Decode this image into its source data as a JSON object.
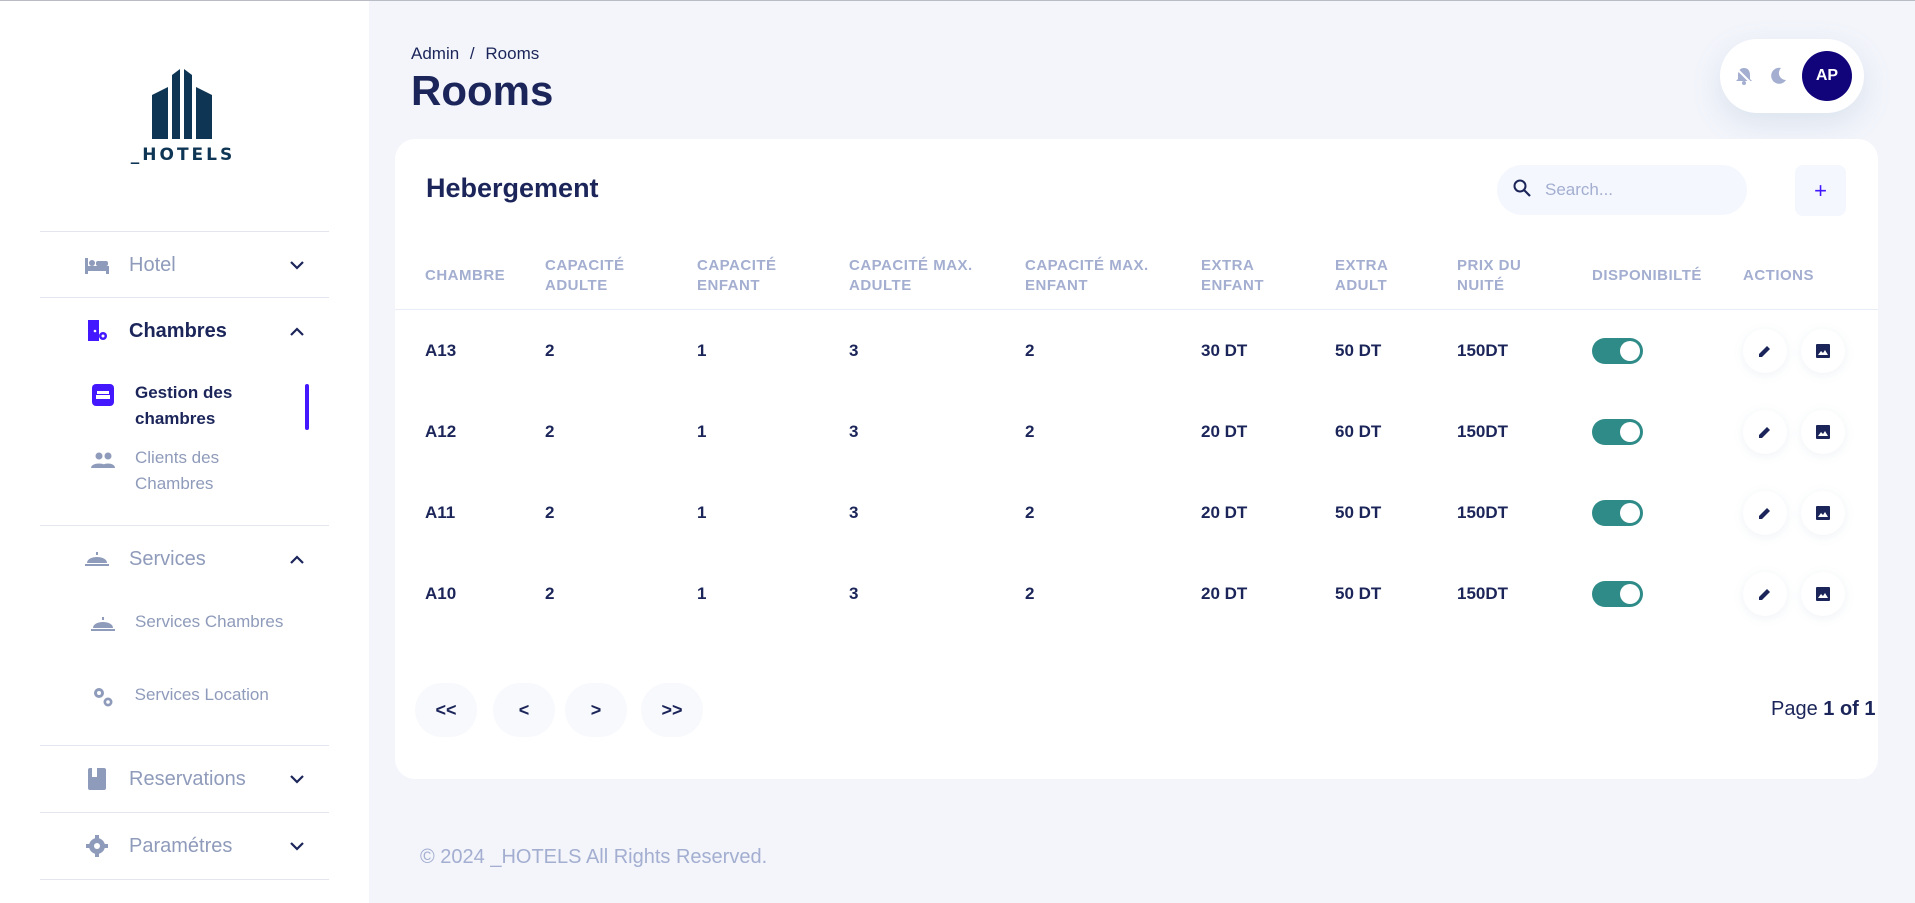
{
  "brand": {
    "logo_text": "_HOTELS"
  },
  "sidebar": {
    "groups": [
      {
        "label": "Hotel",
        "icon": "bed-icon"
      },
      {
        "label": "Chambres",
        "icon": "room-settings-icon"
      },
      {
        "label": "Services",
        "icon": "room-service-icon"
      },
      {
        "label": "Reservations",
        "icon": "book-icon"
      },
      {
        "label": "Paramétres",
        "icon": "gear-icon"
      }
    ],
    "chambres_items": [
      {
        "label": "Gestion des chambres",
        "icon": "hotel-icon"
      },
      {
        "label": "Clients des Chambres",
        "icon": "people-icon"
      }
    ],
    "services_items": [
      {
        "label": "Services Chambres",
        "icon": "room-service-icon"
      },
      {
        "label": "Services Location",
        "icon": "gears-icon"
      }
    ]
  },
  "header": {
    "breadcrumb": [
      "Admin",
      "/",
      "Rooms"
    ],
    "title": "Rooms",
    "avatar_initials": "AP"
  },
  "card": {
    "title": "Hebergement",
    "search_placeholder": "Search...",
    "add_label": "+"
  },
  "table": {
    "columns": [
      [
        "CHAMBRE"
      ],
      [
        "CAPACITÉ",
        "ADULTE"
      ],
      [
        "CAPACITÉ",
        "ENFANT"
      ],
      [
        "CAPACITÉ MAX.",
        "ADULTE"
      ],
      [
        "CAPACITÉ MAX.",
        "ENFANT"
      ],
      [
        "EXTRA",
        "ENFANT"
      ],
      [
        "EXTRA",
        "ADULT"
      ],
      [
        "PRIX DU",
        "NUITÉ"
      ],
      [
        "DISPONIBILTÉ"
      ],
      [
        "ACTIONS"
      ]
    ],
    "rows": [
      {
        "chambre": "A13",
        "cap_adulte": "2",
        "cap_enfant": "1",
        "max_adulte": "3",
        "max_enfant": "2",
        "extra_enfant": "30 DT",
        "extra_adult": "50 DT",
        "prix": "150DT",
        "disponible": true
      },
      {
        "chambre": "A12",
        "cap_adulte": "2",
        "cap_enfant": "1",
        "max_adulte": "3",
        "max_enfant": "2",
        "extra_enfant": "20 DT",
        "extra_adult": "60 DT",
        "prix": "150DT",
        "disponible": true
      },
      {
        "chambre": "A11",
        "cap_adulte": "2",
        "cap_enfant": "1",
        "max_adulte": "3",
        "max_enfant": "2",
        "extra_enfant": "20 DT",
        "extra_adult": "50 DT",
        "prix": "150DT",
        "disponible": true
      },
      {
        "chambre": "A10",
        "cap_adulte": "2",
        "cap_enfant": "1",
        "max_adulte": "3",
        "max_enfant": "2",
        "extra_enfant": "20 DT",
        "extra_adult": "50 DT",
        "prix": "150DT",
        "disponible": true
      }
    ]
  },
  "pagination": {
    "first": "<<",
    "prev": "<",
    "next": ">",
    "last": ">>",
    "page_prefix": "Page",
    "page_value": "1 of 1"
  },
  "footer": {
    "text": "© 2024 _HOTELS All Rights Reserved."
  },
  "colors": {
    "accent": "#4318ff",
    "navy": "#1b2559",
    "muted": "#a3aed0",
    "toggle": "#2e8b87",
    "avatar": "#11047a",
    "logo": "#0e3554"
  }
}
